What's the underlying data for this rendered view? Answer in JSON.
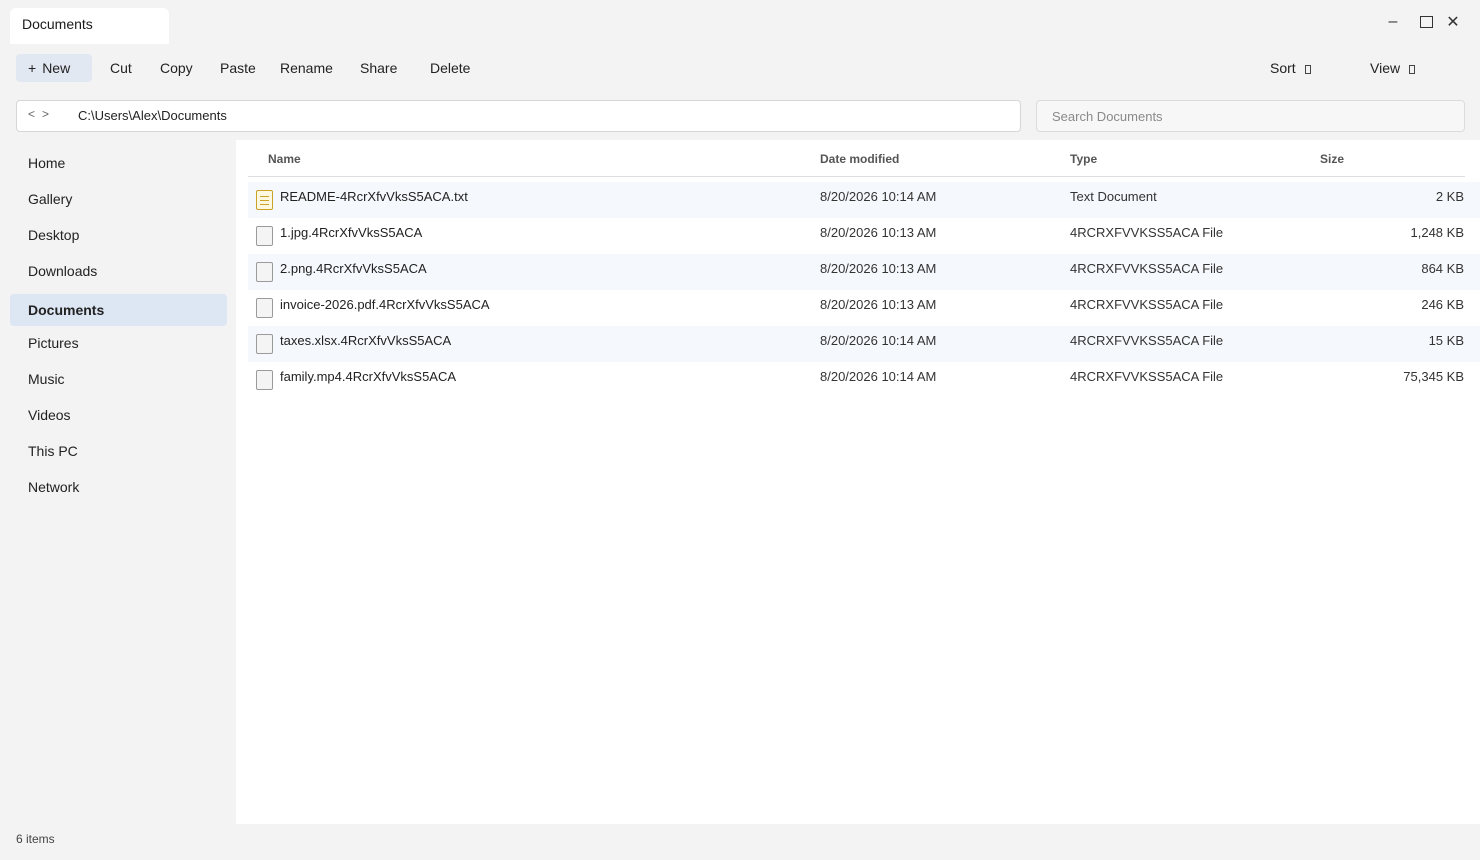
{
  "window": {
    "tab_title": "Documents",
    "controls": {
      "minimize": "–",
      "close": "✕"
    }
  },
  "toolbar": {
    "new_icon": "+",
    "new_label": "New",
    "cut_label": "Cut",
    "copy_label": "Copy",
    "paste_label": "Paste",
    "rename_label": "Rename",
    "share_label": "Share",
    "delete_label": "Delete",
    "sort_label": "Sort",
    "view_label": "View"
  },
  "address": {
    "back": "<",
    "forward": ">",
    "path": "C:\\Users\\Alex\\Documents"
  },
  "search": {
    "placeholder": "Search Documents",
    "value": ""
  },
  "sidebar": {
    "items": [
      {
        "label": "Home"
      },
      {
        "label": "Gallery"
      },
      {
        "label": "Desktop"
      },
      {
        "label": "Downloads"
      },
      {
        "label": "Documents",
        "active": true
      },
      {
        "label": "Pictures"
      },
      {
        "label": "Music"
      },
      {
        "label": "Videos"
      },
      {
        "label": "This PC"
      },
      {
        "label": "Network"
      }
    ]
  },
  "file_list": {
    "columns": {
      "name": "Name",
      "date": "Date modified",
      "type": "Type",
      "size": "Size"
    },
    "rows": [
      {
        "name": "README-4RcrXfvVksS5ACA.txt",
        "date": "8/20/2026 10:14 AM",
        "type": "Text Document",
        "size": "2 KB",
        "icon": "text-file-icon"
      },
      {
        "name": "1.jpg.4RcrXfvVksS5ACA",
        "date": "8/20/2026 10:13 AM",
        "type": "4RCRXFVVKSS5ACA File",
        "size": "1,248 KB",
        "icon": "file-icon"
      },
      {
        "name": "2.png.4RcrXfvVksS5ACA",
        "date": "8/20/2026 10:13 AM",
        "type": "4RCRXFVVKSS5ACA File",
        "size": "864 KB",
        "icon": "file-icon"
      },
      {
        "name": "invoice-2026.pdf.4RcrXfvVksS5ACA",
        "date": "8/20/2026 10:13 AM",
        "type": "4RCRXFVVKSS5ACA File",
        "size": "246 KB",
        "icon": "file-icon"
      },
      {
        "name": "taxes.xlsx.4RcrXfvVksS5ACA",
        "date": "8/20/2026 10:14 AM",
        "type": "4RCRXFVVKSS5ACA File",
        "size": "15 KB",
        "icon": "file-icon"
      },
      {
        "name": "family.mp4.4RcrXfvVksS5ACA",
        "date": "8/20/2026 10:14 AM",
        "type": "4RCRXFVVKSS5ACA File",
        "size": "75,345 KB",
        "icon": "file-icon"
      }
    ]
  },
  "status": {
    "item_count": "6 items"
  }
}
